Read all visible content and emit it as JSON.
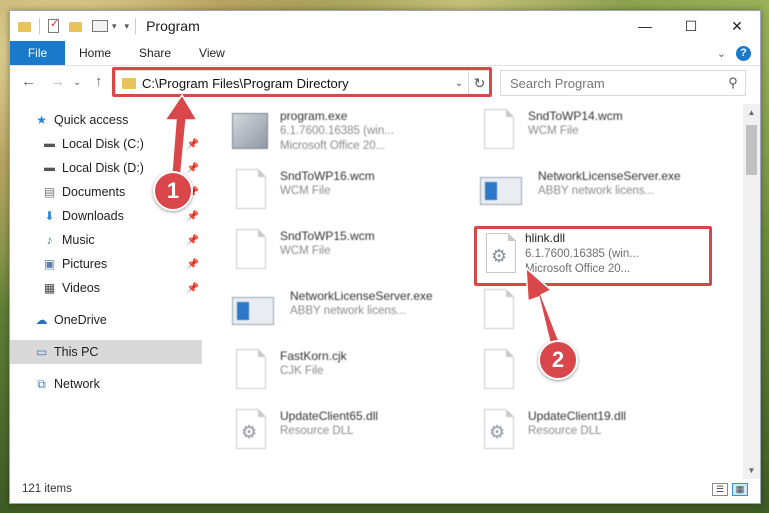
{
  "window": {
    "title": "Program",
    "controls": {
      "minimize": "—",
      "maximize": "☐",
      "close": "✕"
    }
  },
  "ribbon": {
    "file_tab": "File",
    "tabs": [
      "Home",
      "Share",
      "View"
    ],
    "help": "?"
  },
  "address": {
    "path": "C:\\Program Files\\Program Directory"
  },
  "search": {
    "placeholder": "Search Program"
  },
  "sidebar": {
    "items": [
      {
        "label": "Quick access",
        "icon": "star-icon"
      },
      {
        "label": "Local Disk (C:)",
        "icon": "drive-icon",
        "pinned": true
      },
      {
        "label": "Local Disk (D:)",
        "icon": "drive-icon",
        "pinned": true
      },
      {
        "label": "Documents",
        "icon": "documents-icon",
        "pinned": true
      },
      {
        "label": "Downloads",
        "icon": "download-icon",
        "pinned": true
      },
      {
        "label": "Music",
        "icon": "music-icon",
        "pinned": true
      },
      {
        "label": "Pictures",
        "icon": "pictures-icon",
        "pinned": true
      },
      {
        "label": "Videos",
        "icon": "videos-icon",
        "pinned": true
      },
      {
        "label": "OneDrive",
        "icon": "cloud-icon"
      },
      {
        "label": "This PC",
        "icon": "pc-icon",
        "selected": true
      },
      {
        "label": "Network",
        "icon": "network-icon"
      }
    ]
  },
  "files": [
    {
      "name": "program.exe",
      "line1": "6.1.7600.16385 (win...",
      "line2": "Microsoft Office 20...",
      "icon": "exe-icon"
    },
    {
      "name": "SndToWP14.wcm",
      "line1": "WCM File",
      "line2": "",
      "icon": "document-icon"
    },
    {
      "name": "SndToWP16.wcm",
      "line1": "WCM File",
      "line2": "",
      "icon": "document-icon"
    },
    {
      "name": "NetworkLicenseServer.exe",
      "line1": "ABBY network licens...",
      "line2": "",
      "icon": "app-icon"
    },
    {
      "name": "SndToWP15.wcm",
      "line1": "WCM File",
      "line2": "",
      "icon": "document-icon"
    },
    {
      "name": "NetworkLicenseServer.exe",
      "line1": "ABBY network licens...",
      "line2": "",
      "icon": "app-icon"
    },
    {
      "name": "FastKorn.cjk",
      "line1": "CJK File",
      "line2": "",
      "icon": "document-icon"
    },
    {
      "name": "UpdateClient65.dll",
      "line1": "Resource DLL",
      "line2": "",
      "icon": "dll-icon"
    },
    {
      "name": "UpdateClient19.dll",
      "line1": "Resource DLL",
      "line2": "",
      "icon": "dll-icon"
    }
  ],
  "highlighted_file": {
    "name": "hlink.dll",
    "line1": "6.1.7600.16385 (win...",
    "line2": "Microsoft Office 20..."
  },
  "status": {
    "count": "121 items"
  },
  "callouts": [
    "1",
    "2"
  ],
  "colors": {
    "accent": "#1979ca",
    "highlight": "#d9474b"
  }
}
